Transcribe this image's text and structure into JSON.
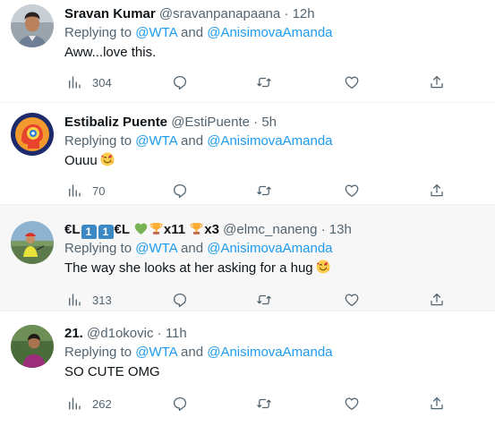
{
  "tweets": [
    {
      "name": "Sravan Kumar",
      "handle": "@sravanpanapaana",
      "dot": "·",
      "time": "12h",
      "replying_prefix": "Replying to ",
      "mention1": "@WTA",
      "and": " and ",
      "mention2": "@AnisimovaAmanda",
      "text": "Aww...love this.",
      "stats_count": "304"
    },
    {
      "name": "Estibaliz Puente",
      "handle": "@EstiPuente",
      "dot": "·",
      "time": "5h",
      "replying_prefix": "Replying to ",
      "mention1": "@WTA",
      "and": " and ",
      "mention2": "@AnisimovaAmanda",
      "text": "Ouuu",
      "stats_count": "70"
    },
    {
      "name_part1": "€L",
      "badge1": "1",
      "badge2": "1",
      "name_part2": "€L",
      "trophy_count1": "x11",
      "trophy_count2": "x3",
      "handle": "@elmc_naneng",
      "dot": "·",
      "time": "13h",
      "replying_prefix": "Replying to ",
      "mention1": "@WTA",
      "and": " and ",
      "mention2": "@AnisimovaAmanda",
      "text": "The way she looks at her asking for a hug",
      "stats_count": "313"
    },
    {
      "name": "21.",
      "handle": "@d1okovic",
      "dot": "·",
      "time": "11h",
      "replying_prefix": "Replying to ",
      "mention1": "@WTA",
      "and": " and ",
      "mention2": "@AnisimovaAmanda",
      "text": "SO CUTE OMG",
      "stats_count": "262"
    }
  ],
  "icons": {
    "stats": "bar-chart-icon",
    "reply": "speech-bubble-icon",
    "retweet": "retweet-icon",
    "like": "heart-icon",
    "share": "share-icon"
  },
  "colors": {
    "mention": "#1d9bf0",
    "secondary_text": "#536471",
    "highlight_background": "#f7f7f7"
  }
}
